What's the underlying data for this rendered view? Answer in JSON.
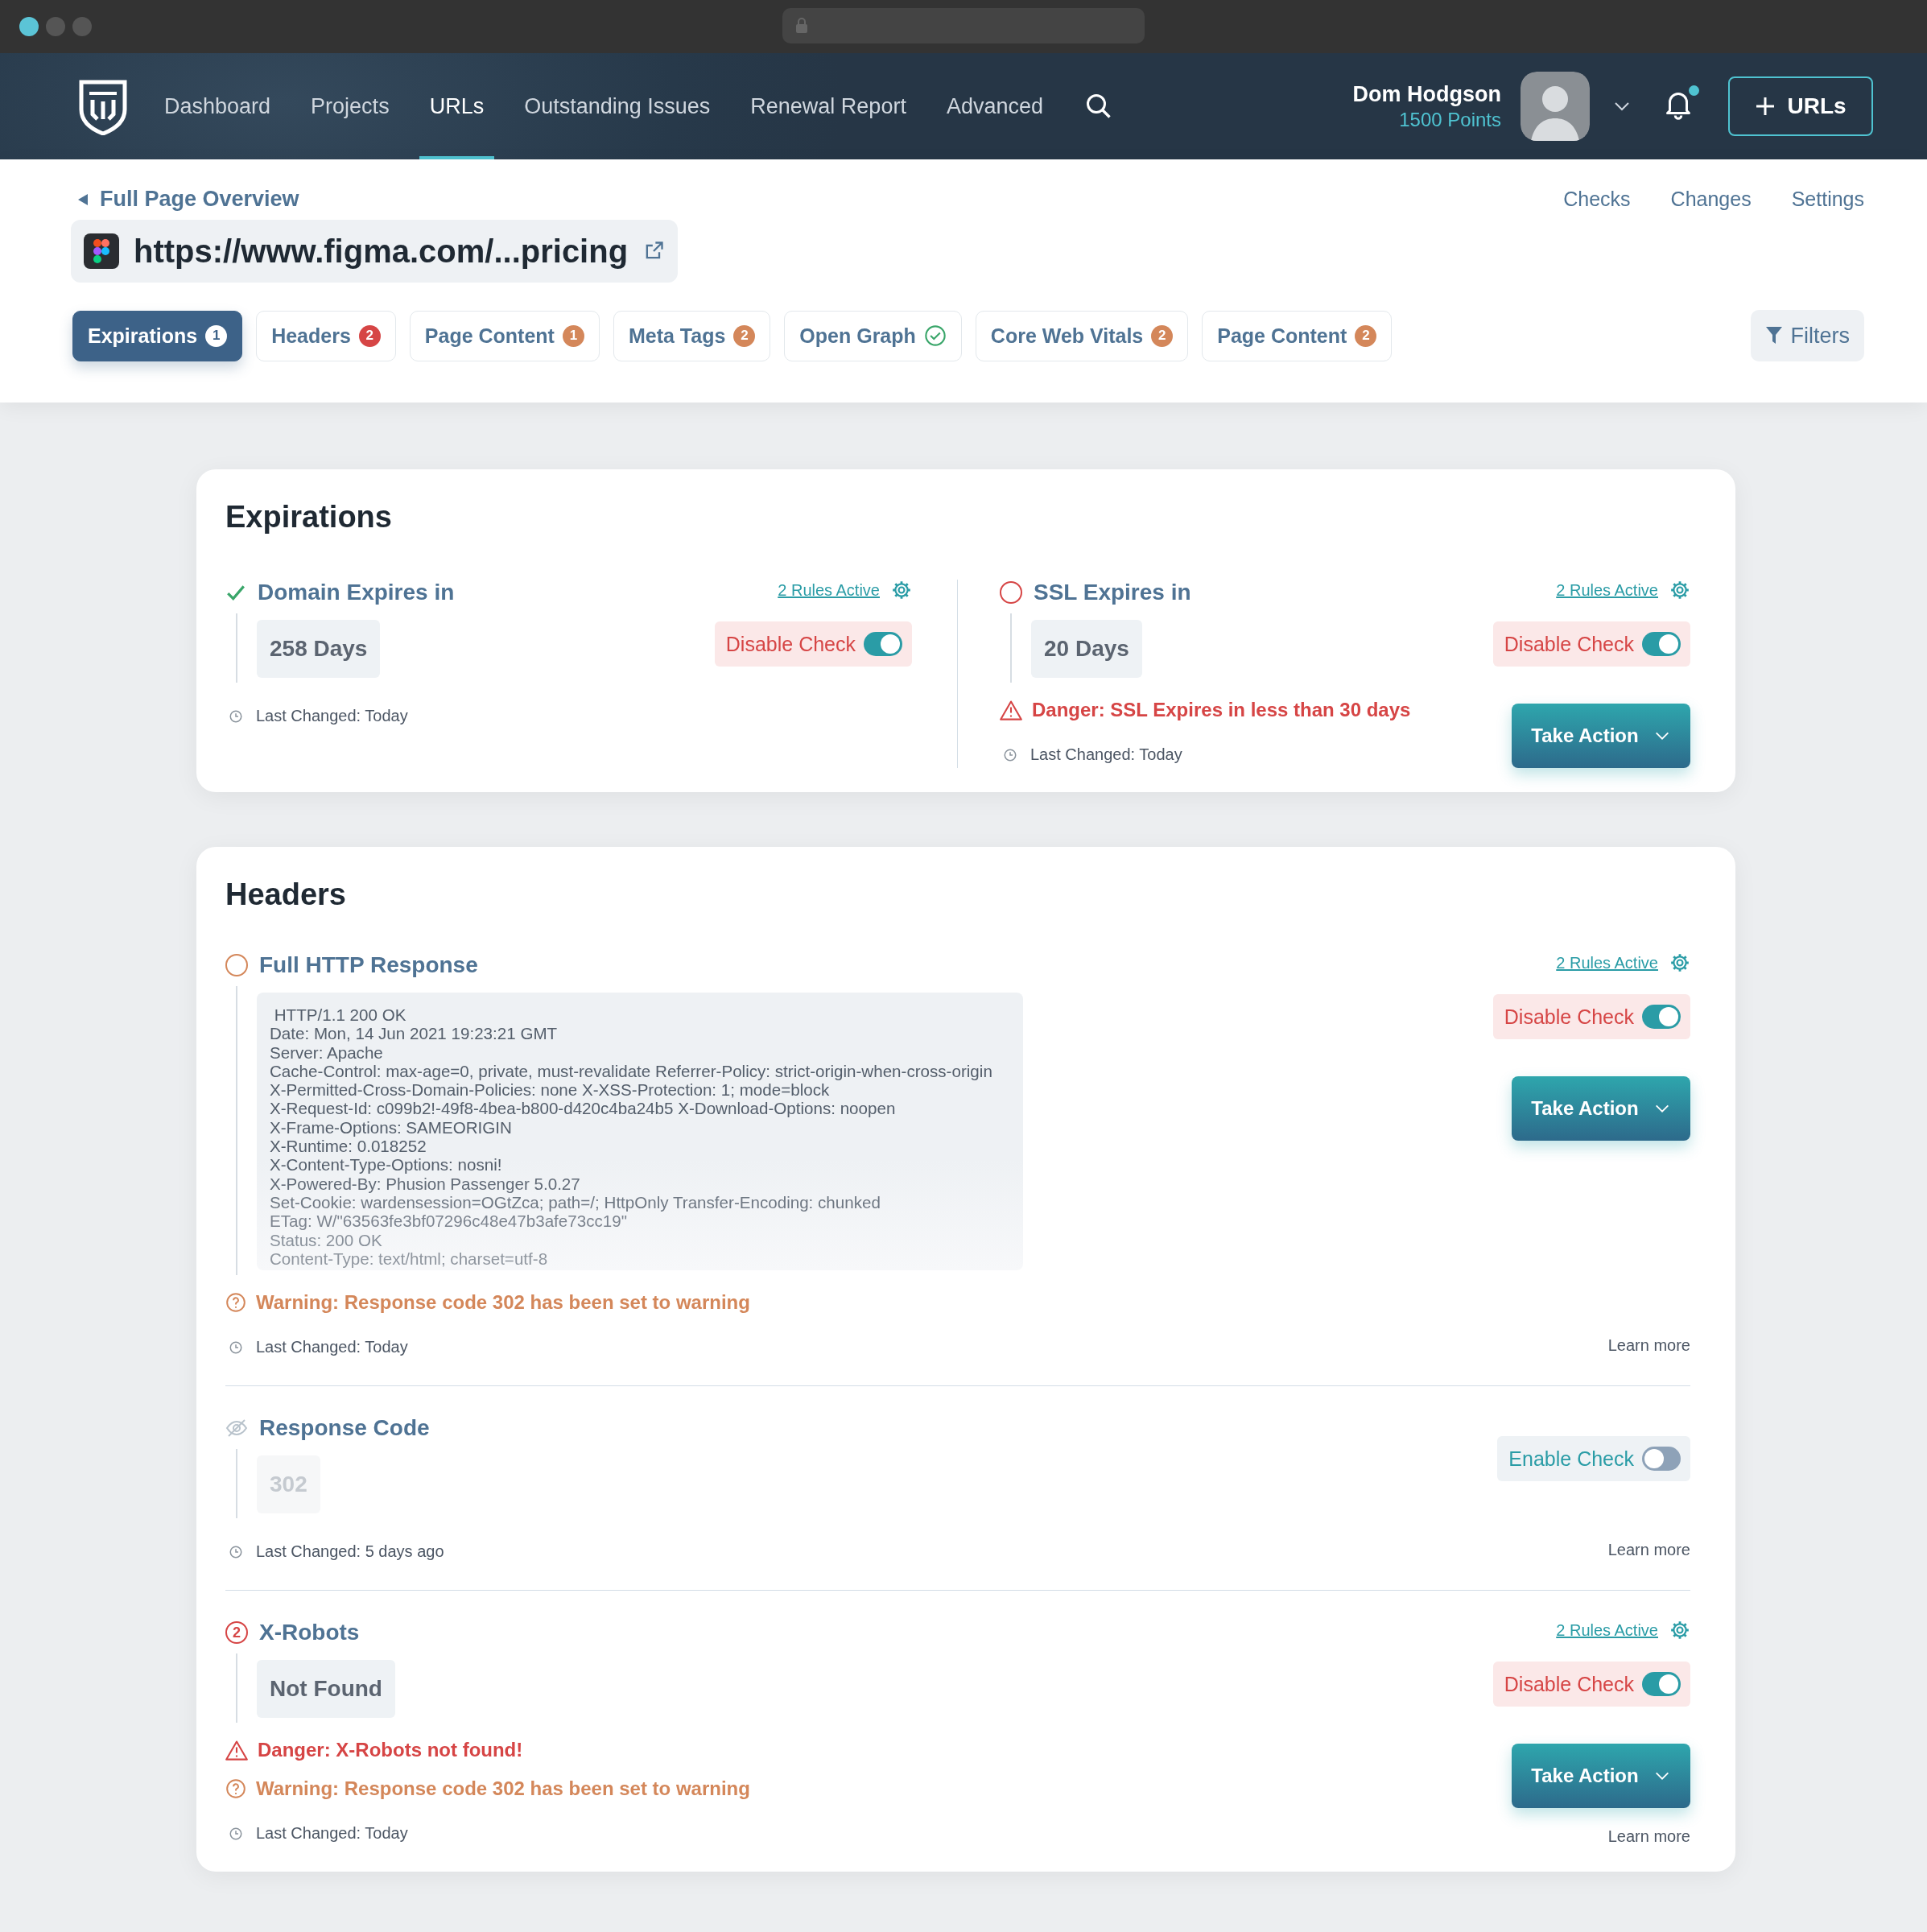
{
  "nav": {
    "items": [
      {
        "label": "Dashboard",
        "selected": false
      },
      {
        "label": "Projects",
        "selected": false
      },
      {
        "label": "URLs",
        "selected": true
      },
      {
        "label": "Outstanding Issues",
        "selected": false
      },
      {
        "label": "Renewal Report",
        "selected": false
      },
      {
        "label": "Advanced",
        "selected": false
      }
    ],
    "user": {
      "name": "Dom Hodgson",
      "points": "1500 Points"
    },
    "notifications": {
      "unread": true
    },
    "add_button": "URLs"
  },
  "page_header": {
    "back": "Full Page Overview",
    "links": [
      "Checks",
      "Changes",
      "Settings"
    ],
    "url": "https://www.figma.com/...pricing"
  },
  "tabs": [
    {
      "label": "Expirations",
      "selected": true,
      "kind": "count",
      "badge": "1"
    },
    {
      "label": "Headers",
      "selected": false,
      "kind": "count",
      "badge": "2",
      "color": "#d64545"
    },
    {
      "label": "Page Content",
      "selected": false,
      "kind": "count",
      "badge": "1",
      "color": "#d4875a"
    },
    {
      "label": "Meta Tags",
      "selected": false,
      "kind": "count",
      "badge": "2",
      "color": "#d4875a"
    },
    {
      "label": "Open Graph",
      "selected": false,
      "kind": "check"
    },
    {
      "label": "Core Web Vitals",
      "selected": false,
      "kind": "count",
      "badge": "2",
      "color": "#d4875a"
    },
    {
      "label": "Page Content",
      "selected": false,
      "kind": "count",
      "badge": "2",
      "color": "#d4875a"
    }
  ],
  "filters": "Filters",
  "sections": [
    {
      "title": "Expirations",
      "kind": "columns",
      "checks": [
        {
          "title": "Domain Expires in",
          "kind": "ok",
          "rules": "2 Rules Active",
          "toggle": {
            "label": "Disable Check",
            "on": true
          },
          "value": "258 Days",
          "last_changed": "Last Changed: Today"
        },
        {
          "title": "SSL Expires in",
          "kind": "danger",
          "rules": "2 Rules Active",
          "toggle": {
            "label": "Disable Check",
            "on": true
          },
          "value": "20 Days",
          "messages": [
            {
              "kind": "danger",
              "text": "Danger: SSL Expires in less than 30 days"
            }
          ],
          "last_changed": "Last Changed: Today",
          "action": "Take Action"
        }
      ]
    },
    {
      "title": "Headers",
      "kind": "rows",
      "checks": [
        {
          "title": "Full HTTP Response",
          "kind": "warning",
          "rules": "2 Rules Active",
          "toggle": {
            "label": "Disable Check",
            "on": true
          },
          "code": [
            " HTTP/1.1 200 OK",
            "Date: Mon, 14 Jun 2021 19:23:21 GMT",
            "Server: Apache",
            "Cache-Control: max-age=0, private, must-revalidate Referrer-Policy: strict-origin-when-cross-origin",
            "X-Permitted-Cross-Domain-Policies: none X-XSS-Protection: 1; mode=block",
            "X-Request-Id: c099b2!-49f8-4bea-b800-d420c4ba24b5 X-Download-Options: noopen",
            "X-Frame-Options: SAMEORIGIN",
            "X-Runtime: 0.018252",
            "X-Content-Type-Options: nosni!",
            "X-Powered-By: Phusion Passenger 5.0.27",
            "Set-Cookie: wardensession=OGtZca; path=/; HttpOnly Transfer-Encoding: chunked",
            "ETag: W/\"63563fe3bf07296c48e47b3afe73cc19\"",
            "Status: 200 OK",
            "Content-Type: text/html; charset=utf-8"
          ],
          "messages": [
            {
              "kind": "warning",
              "text": "Warning: Response code 302 has been set to warning"
            }
          ],
          "last_changed": "Last Changed: Today",
          "action": "Take Action",
          "learn_more": "Learn more"
        },
        {
          "title": "Response Code",
          "kind": "disabled",
          "toggle": {
            "label": "Enable Check",
            "on": false
          },
          "value": "302",
          "last_changed": "Last Changed: 5 days ago",
          "learn_more": "Learn more"
        },
        {
          "title": "X-Robots",
          "kind": "danger",
          "status_text": "2",
          "rules": "2 Rules Active",
          "toggle": {
            "label": "Disable Check",
            "on": true
          },
          "value": "Not Found",
          "messages": [
            {
              "kind": "danger",
              "text": "Danger: X-Robots not found!"
            },
            {
              "kind": "warning",
              "text": "Warning: Response code 302 has been set to warning"
            }
          ],
          "last_changed": "Last Changed: Today",
          "action": "Take Action",
          "learn_more": "Learn more"
        }
      ]
    }
  ]
}
